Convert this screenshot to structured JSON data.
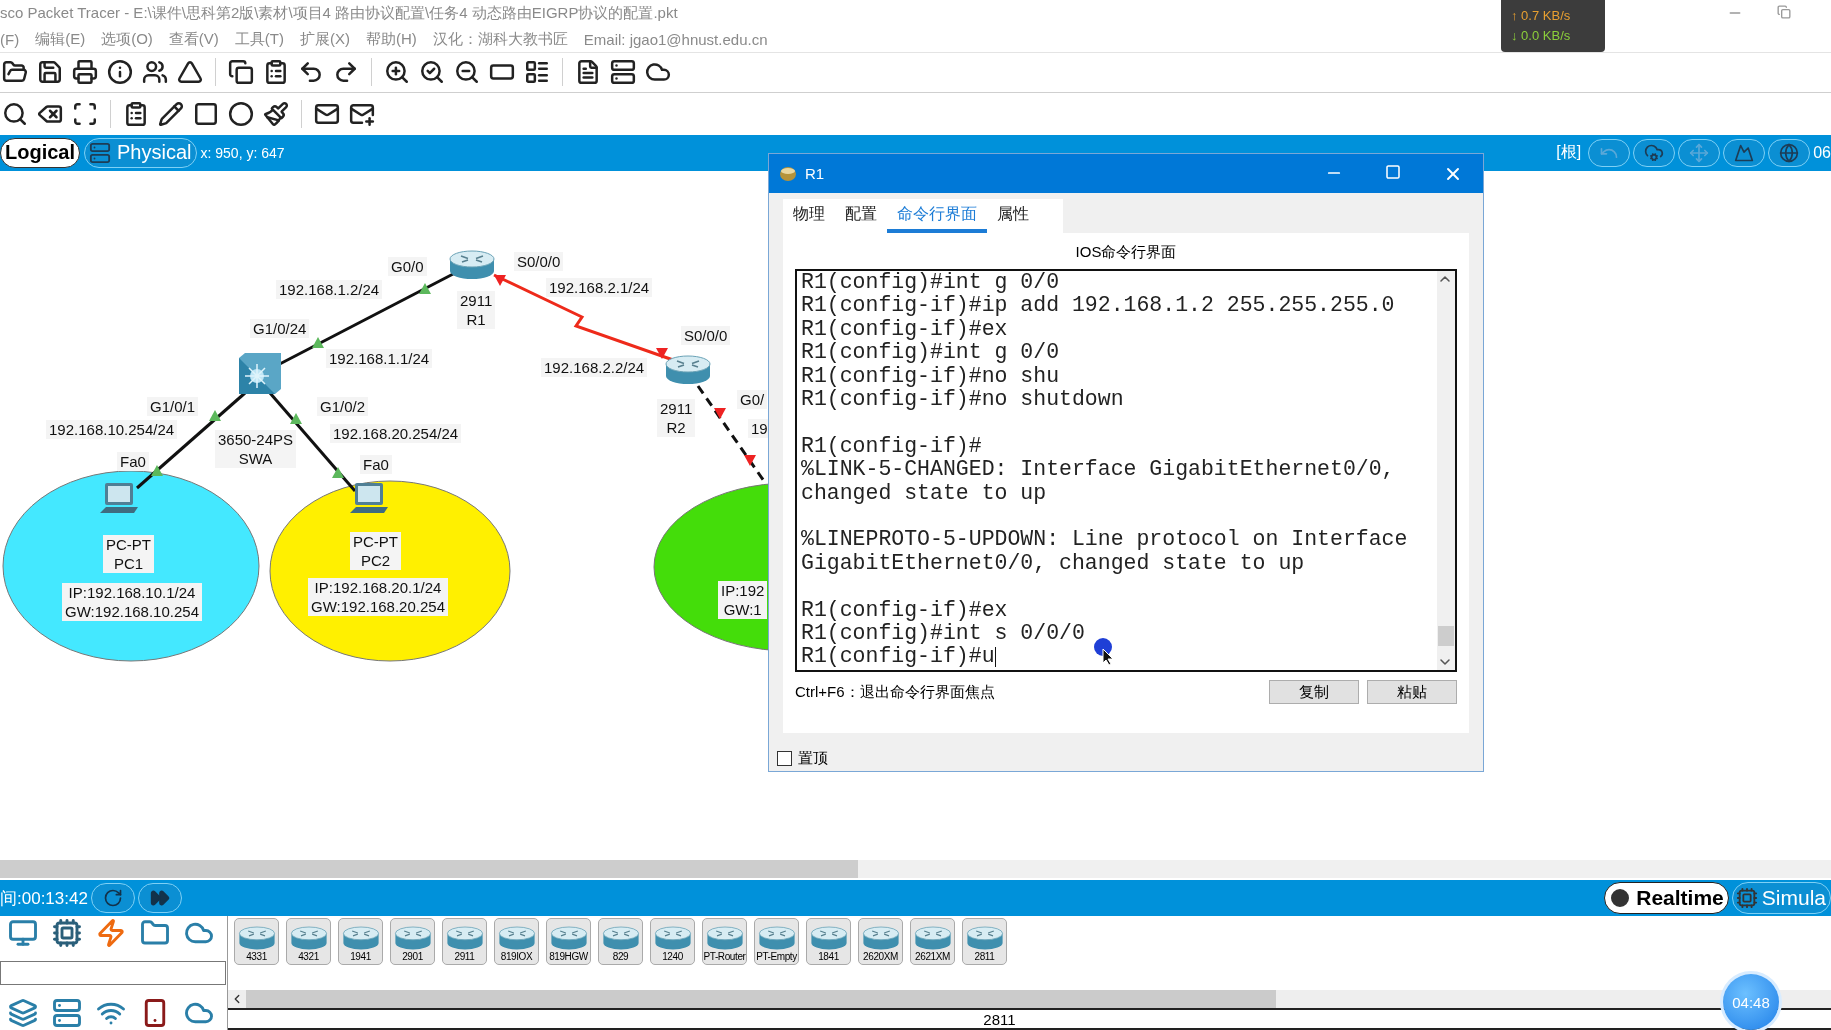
{
  "window": {
    "title": "sco Packet Tracer - E:\\课件\\思科第2版\\素材\\项目4 路由协议配置\\任务4 动态路由EIGRP协议的配置.pkt"
  },
  "menu": [
    "(F)",
    "编辑(E)",
    "选项(O)",
    "查看(V)",
    "工具(T)",
    "扩展(X)",
    "帮助(H)"
  ],
  "credits": [
    "汉化：湖科大教书匠",
    "Email: jgao1@hnust.edu.cn"
  ],
  "net_speed": {
    "upload": "↑ 0.7 KB/s",
    "download": "↓ 0.0 KB/s"
  },
  "workspace_bar": {
    "views": [
      {
        "label": "Logical",
        "selected": true
      },
      {
        "label": "Physical",
        "selected": false
      }
    ],
    "coords": "x: 950, y: 647",
    "root": "[根]",
    "clock": "06"
  },
  "diagram": {
    "zones": [
      {
        "color": "#44e8ff"
      },
      {
        "color": "#fff000"
      },
      {
        "color": "#44dd0a"
      }
    ],
    "links": [
      {
        "kind": "ethernet",
        "up": true
      },
      {
        "kind": "serial",
        "up": false
      },
      {
        "kind": "ethernet",
        "up": true
      },
      {
        "kind": "ethernet",
        "up": true
      },
      {
        "kind": "crossover",
        "up": false
      }
    ],
    "labels": [
      [
        "G0/0"
      ],
      [
        "S0/0/0"
      ],
      [
        "192.168.1.2/24"
      ],
      [
        "2911",
        "R1"
      ],
      [
        "192.168.2.1/24"
      ],
      [
        "G1/0/24"
      ],
      [
        "S0/0/0"
      ],
      [
        "192.168.1.1/24"
      ],
      [
        "192.168.2.2/24"
      ],
      [
        "G1/0/1"
      ],
      [
        "G1/0/2"
      ],
      [
        "2911",
        "R2"
      ],
      [
        "G0/"
      ],
      [
        "192.168.10.254/24"
      ],
      [
        "3650-24PS",
        "SWA"
      ],
      [
        "192.168.20.254/24"
      ],
      [
        "19"
      ],
      [
        "Fa0"
      ],
      [
        "Fa0"
      ],
      [
        "PC-PT",
        "PC1"
      ],
      [
        "PC-PT",
        "PC2"
      ],
      [
        "IP:192.168.10.1/24",
        "GW:192.168.10.254"
      ],
      [
        "IP:192.168.20.1/24",
        "GW:192.168.20.254"
      ],
      [
        "IP:192",
        "GW:1"
      ]
    ]
  },
  "dialog": {
    "title": "R1",
    "tabs": [
      {
        "label": "物理",
        "selected": false
      },
      {
        "label": "配置",
        "selected": false
      },
      {
        "label": "命令行界面",
        "selected": true
      },
      {
        "label": "属性",
        "selected": false
      }
    ],
    "heading": "IOS命令行界面",
    "terminal_blocks": [
      [
        "R1(config)#int g 0/0",
        "R1(config-if)#ip add 192.168.1.2 255.255.255.0",
        "R1(config-if)#ex",
        "R1(config)#int g 0/0",
        "R1(config-if)#no shu",
        "R1(config-if)#no shutdown"
      ],
      [
        "R1(config-if)#",
        "%LINK-5-CHANGED: Interface GigabitEthernet0/0,",
        "changed state to up"
      ],
      [
        "%LINEPROTO-5-UPDOWN: Line protocol on Interface",
        "GigabitEthernet0/0, changed state to up"
      ],
      [
        "R1(config-if)#ex",
        "R1(config)#int s 0/0/0",
        "R1(config-if)#u"
      ]
    ],
    "shortcut": "Ctrl+F6：退出命令行界面焦点",
    "buttons": [
      "复制",
      "粘贴"
    ],
    "pin": {
      "label": "置顶",
      "checked": false
    }
  },
  "sim_bar": {
    "time": "间:00:13:42",
    "modes": [
      {
        "label": "Realtime",
        "selected": true
      },
      {
        "label": "Simula",
        "selected": false
      }
    ]
  },
  "palette": {
    "devices": [
      "4331",
      "4321",
      "1941",
      "2901",
      "2911",
      "819IOX",
      "819HGW",
      "829",
      "1240",
      "PT-Router",
      "PT-Empty",
      "1841",
      "2620XM",
      "2621XM",
      "2811"
    ],
    "selected_model": "2811"
  },
  "recorder": {
    "timer": "04:48"
  }
}
